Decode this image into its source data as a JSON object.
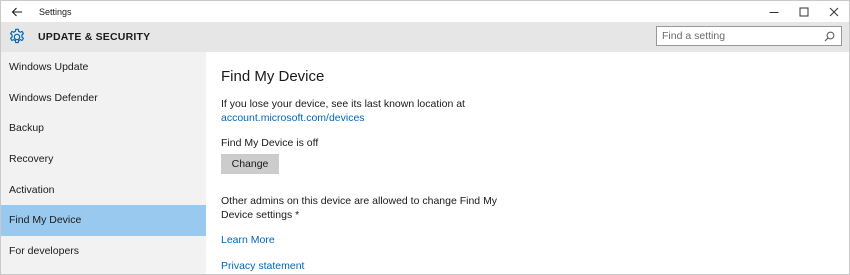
{
  "window": {
    "title": "Settings"
  },
  "header": {
    "title": "UPDATE & SECURITY",
    "icon": "gear-icon",
    "search_placeholder": "Find a setting"
  },
  "sidebar": {
    "items": [
      {
        "label": "Windows Update",
        "selected": false
      },
      {
        "label": "Windows Defender",
        "selected": false
      },
      {
        "label": "Backup",
        "selected": false
      },
      {
        "label": "Recovery",
        "selected": false
      },
      {
        "label": "Activation",
        "selected": false
      },
      {
        "label": "Find My Device",
        "selected": true
      },
      {
        "label": "For developers",
        "selected": false
      }
    ]
  },
  "main": {
    "title": "Find My Device",
    "description": "If you lose your device, see its last known location at",
    "account_link": "account.microsoft.com/devices",
    "status": "Find My Device is off",
    "change_button": "Change",
    "admins_note": "Other admins on this device are allowed to change Find My Device settings *",
    "learn_more": "Learn More",
    "privacy_statement": "Privacy statement"
  },
  "colors": {
    "accent": "#0067b8",
    "selected_nav": "#99c9ef",
    "sidebar_bg": "#f2f2f2",
    "header_bg": "#e6e6e6",
    "button_bg": "#cccccc"
  }
}
